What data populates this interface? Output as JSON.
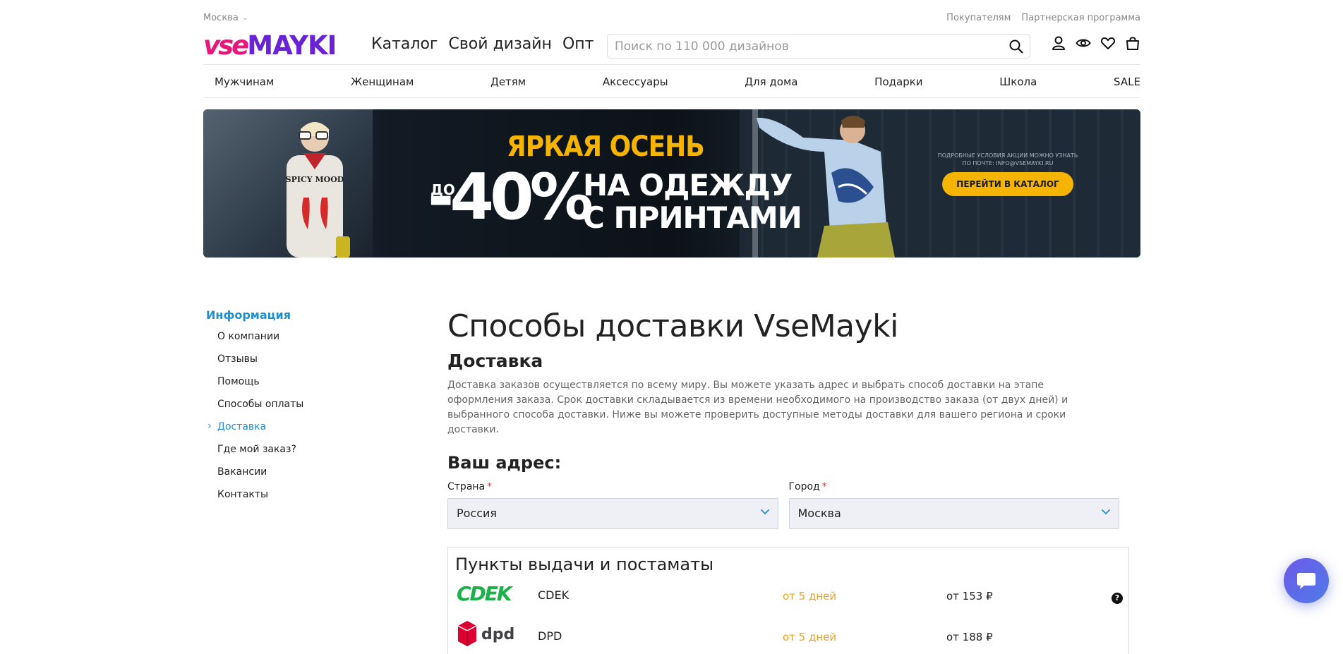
{
  "topbar": {
    "city": "Москва",
    "links": [
      "Покупателям",
      "Партнерская программа"
    ]
  },
  "header": {
    "logo_part1": "vse",
    "logo_part2": "MAYKI",
    "main_nav": [
      "Каталог",
      "Свой дизайн",
      "Опт"
    ],
    "search_placeholder": "Поиск по 110 000 дизайнов",
    "icons": [
      "user-icon",
      "eye-icon",
      "heart-icon",
      "bag-icon"
    ]
  },
  "categories": [
    "Мужчинам",
    "Женщинам",
    "Детям",
    "Аксессуары",
    "Для дома",
    "Подарки",
    "Школа",
    "SALE"
  ],
  "banner": {
    "headline": "ЯРКАЯ ОСЕНЬ",
    "prefix": "ДО",
    "discount": "-40%",
    "line1": "НА ОДЕЖДУ",
    "line2": "С ПРИНТАМИ",
    "fine_print": "ПОДРОБНЫЕ УСЛОВИЯ АКЦИИ МОЖНО УЗНАТЬ ПО ПОЧТЕ: INFO@VSEMAYKI.RU",
    "cta": "ПЕРЕЙТИ В КАТАЛОГ",
    "shirt_text": "SPICY MOOD"
  },
  "sidebar": {
    "heading": "Информация",
    "items": [
      "О компании",
      "Отзывы",
      "Помощь",
      "Способы оплаты",
      "Доставка",
      "Где мой заказ?",
      "Вакансии",
      "Контакты"
    ],
    "active": "Доставка"
  },
  "main": {
    "title": "Способы доставки VseMayki",
    "subtitle": "Доставка",
    "description": "Доставка заказов осуществляется по всему миру. Вы можете указать адрес и выбрать способ доставки на этапе оформления заказа. Срок доставки складывается из времени необходимого на производство заказа (от двух дней) и выбранного способа доставки. Ниже вы можете проверить доступные методы доставки для вашего региона и сроки доставки.",
    "address_heading": "Ваш адрес:",
    "country_label": "Страна",
    "country_value": "Россия",
    "city_label": "Город",
    "city_value": "Москва",
    "required_mark": "*",
    "pickup_heading": "Пункты выдачи и постаматы",
    "pickup_rows": [
      {
        "logo": "CDEK",
        "name": "CDEK",
        "days": "от 5 дней",
        "price": "от 153 ₽",
        "help": "?"
      },
      {
        "logo": "dpd",
        "name": "DPD",
        "days": "от 5 дней",
        "price": "от 188 ₽"
      }
    ]
  },
  "colors": {
    "accent": "#1e90d0",
    "logo_pink": "#e8157a",
    "logo_purple": "#6a22d6",
    "banner_yellow": "#f5b400",
    "days_orange": "#f0a020",
    "cdek_green": "#1ab248",
    "dpd_red": "#dc0032"
  }
}
